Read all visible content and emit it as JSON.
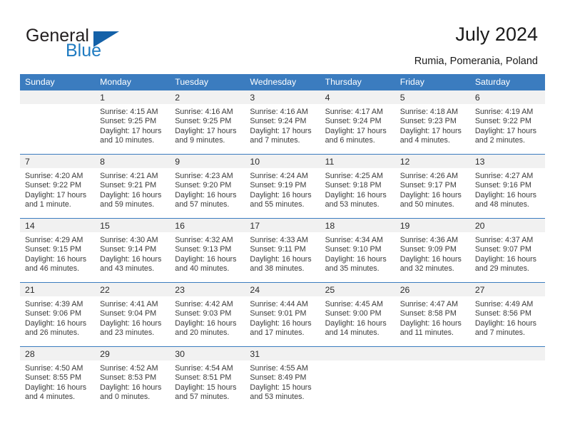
{
  "brand": {
    "name_part1": "General",
    "name_part2": "Blue",
    "accent_color": "#1f7bc1",
    "triangle_color": "#1461a8"
  },
  "header": {
    "title": "July 2024",
    "location": "Rumia, Pomerania, Poland"
  },
  "theme": {
    "header_row_bg": "#3b7cbf",
    "daynum_band_bg": "#f1f1f1",
    "grid_line": "#3b7cbf",
    "text": "#3a3a3a"
  },
  "weekday_headers": [
    "Sunday",
    "Monday",
    "Tuesday",
    "Wednesday",
    "Thursday",
    "Friday",
    "Saturday"
  ],
  "weeks": [
    [
      {
        "day": "",
        "sunrise": "",
        "sunset": "",
        "daylight_line1": "",
        "daylight_line2": ""
      },
      {
        "day": "1",
        "sunrise": "Sunrise: 4:15 AM",
        "sunset": "Sunset: 9:25 PM",
        "daylight_line1": "Daylight: 17 hours",
        "daylight_line2": "and 10 minutes."
      },
      {
        "day": "2",
        "sunrise": "Sunrise: 4:16 AM",
        "sunset": "Sunset: 9:25 PM",
        "daylight_line1": "Daylight: 17 hours",
        "daylight_line2": "and 9 minutes."
      },
      {
        "day": "3",
        "sunrise": "Sunrise: 4:16 AM",
        "sunset": "Sunset: 9:24 PM",
        "daylight_line1": "Daylight: 17 hours",
        "daylight_line2": "and 7 minutes."
      },
      {
        "day": "4",
        "sunrise": "Sunrise: 4:17 AM",
        "sunset": "Sunset: 9:24 PM",
        "daylight_line1": "Daylight: 17 hours",
        "daylight_line2": "and 6 minutes."
      },
      {
        "day": "5",
        "sunrise": "Sunrise: 4:18 AM",
        "sunset": "Sunset: 9:23 PM",
        "daylight_line1": "Daylight: 17 hours",
        "daylight_line2": "and 4 minutes."
      },
      {
        "day": "6",
        "sunrise": "Sunrise: 4:19 AM",
        "sunset": "Sunset: 9:22 PM",
        "daylight_line1": "Daylight: 17 hours",
        "daylight_line2": "and 2 minutes."
      }
    ],
    [
      {
        "day": "7",
        "sunrise": "Sunrise: 4:20 AM",
        "sunset": "Sunset: 9:22 PM",
        "daylight_line1": "Daylight: 17 hours",
        "daylight_line2": "and 1 minute."
      },
      {
        "day": "8",
        "sunrise": "Sunrise: 4:21 AM",
        "sunset": "Sunset: 9:21 PM",
        "daylight_line1": "Daylight: 16 hours",
        "daylight_line2": "and 59 minutes."
      },
      {
        "day": "9",
        "sunrise": "Sunrise: 4:23 AM",
        "sunset": "Sunset: 9:20 PM",
        "daylight_line1": "Daylight: 16 hours",
        "daylight_line2": "and 57 minutes."
      },
      {
        "day": "10",
        "sunrise": "Sunrise: 4:24 AM",
        "sunset": "Sunset: 9:19 PM",
        "daylight_line1": "Daylight: 16 hours",
        "daylight_line2": "and 55 minutes."
      },
      {
        "day": "11",
        "sunrise": "Sunrise: 4:25 AM",
        "sunset": "Sunset: 9:18 PM",
        "daylight_line1": "Daylight: 16 hours",
        "daylight_line2": "and 53 minutes."
      },
      {
        "day": "12",
        "sunrise": "Sunrise: 4:26 AM",
        "sunset": "Sunset: 9:17 PM",
        "daylight_line1": "Daylight: 16 hours",
        "daylight_line2": "and 50 minutes."
      },
      {
        "day": "13",
        "sunrise": "Sunrise: 4:27 AM",
        "sunset": "Sunset: 9:16 PM",
        "daylight_line1": "Daylight: 16 hours",
        "daylight_line2": "and 48 minutes."
      }
    ],
    [
      {
        "day": "14",
        "sunrise": "Sunrise: 4:29 AM",
        "sunset": "Sunset: 9:15 PM",
        "daylight_line1": "Daylight: 16 hours",
        "daylight_line2": "and 46 minutes."
      },
      {
        "day": "15",
        "sunrise": "Sunrise: 4:30 AM",
        "sunset": "Sunset: 9:14 PM",
        "daylight_line1": "Daylight: 16 hours",
        "daylight_line2": "and 43 minutes."
      },
      {
        "day": "16",
        "sunrise": "Sunrise: 4:32 AM",
        "sunset": "Sunset: 9:13 PM",
        "daylight_line1": "Daylight: 16 hours",
        "daylight_line2": "and 40 minutes."
      },
      {
        "day": "17",
        "sunrise": "Sunrise: 4:33 AM",
        "sunset": "Sunset: 9:11 PM",
        "daylight_line1": "Daylight: 16 hours",
        "daylight_line2": "and 38 minutes."
      },
      {
        "day": "18",
        "sunrise": "Sunrise: 4:34 AM",
        "sunset": "Sunset: 9:10 PM",
        "daylight_line1": "Daylight: 16 hours",
        "daylight_line2": "and 35 minutes."
      },
      {
        "day": "19",
        "sunrise": "Sunrise: 4:36 AM",
        "sunset": "Sunset: 9:09 PM",
        "daylight_line1": "Daylight: 16 hours",
        "daylight_line2": "and 32 minutes."
      },
      {
        "day": "20",
        "sunrise": "Sunrise: 4:37 AM",
        "sunset": "Sunset: 9:07 PM",
        "daylight_line1": "Daylight: 16 hours",
        "daylight_line2": "and 29 minutes."
      }
    ],
    [
      {
        "day": "21",
        "sunrise": "Sunrise: 4:39 AM",
        "sunset": "Sunset: 9:06 PM",
        "daylight_line1": "Daylight: 16 hours",
        "daylight_line2": "and 26 minutes."
      },
      {
        "day": "22",
        "sunrise": "Sunrise: 4:41 AM",
        "sunset": "Sunset: 9:04 PM",
        "daylight_line1": "Daylight: 16 hours",
        "daylight_line2": "and 23 minutes."
      },
      {
        "day": "23",
        "sunrise": "Sunrise: 4:42 AM",
        "sunset": "Sunset: 9:03 PM",
        "daylight_line1": "Daylight: 16 hours",
        "daylight_line2": "and 20 minutes."
      },
      {
        "day": "24",
        "sunrise": "Sunrise: 4:44 AM",
        "sunset": "Sunset: 9:01 PM",
        "daylight_line1": "Daylight: 16 hours",
        "daylight_line2": "and 17 minutes."
      },
      {
        "day": "25",
        "sunrise": "Sunrise: 4:45 AM",
        "sunset": "Sunset: 9:00 PM",
        "daylight_line1": "Daylight: 16 hours",
        "daylight_line2": "and 14 minutes."
      },
      {
        "day": "26",
        "sunrise": "Sunrise: 4:47 AM",
        "sunset": "Sunset: 8:58 PM",
        "daylight_line1": "Daylight: 16 hours",
        "daylight_line2": "and 11 minutes."
      },
      {
        "day": "27",
        "sunrise": "Sunrise: 4:49 AM",
        "sunset": "Sunset: 8:56 PM",
        "daylight_line1": "Daylight: 16 hours",
        "daylight_line2": "and 7 minutes."
      }
    ],
    [
      {
        "day": "28",
        "sunrise": "Sunrise: 4:50 AM",
        "sunset": "Sunset: 8:55 PM",
        "daylight_line1": "Daylight: 16 hours",
        "daylight_line2": "and 4 minutes."
      },
      {
        "day": "29",
        "sunrise": "Sunrise: 4:52 AM",
        "sunset": "Sunset: 8:53 PM",
        "daylight_line1": "Daylight: 16 hours",
        "daylight_line2": "and 0 minutes."
      },
      {
        "day": "30",
        "sunrise": "Sunrise: 4:54 AM",
        "sunset": "Sunset: 8:51 PM",
        "daylight_line1": "Daylight: 15 hours",
        "daylight_line2": "and 57 minutes."
      },
      {
        "day": "31",
        "sunrise": "Sunrise: 4:55 AM",
        "sunset": "Sunset: 8:49 PM",
        "daylight_line1": "Daylight: 15 hours",
        "daylight_line2": "and 53 minutes."
      },
      {
        "day": "",
        "sunrise": "",
        "sunset": "",
        "daylight_line1": "",
        "daylight_line2": ""
      },
      {
        "day": "",
        "sunrise": "",
        "sunset": "",
        "daylight_line1": "",
        "daylight_line2": ""
      },
      {
        "day": "",
        "sunrise": "",
        "sunset": "",
        "daylight_line1": "",
        "daylight_line2": ""
      }
    ]
  ]
}
